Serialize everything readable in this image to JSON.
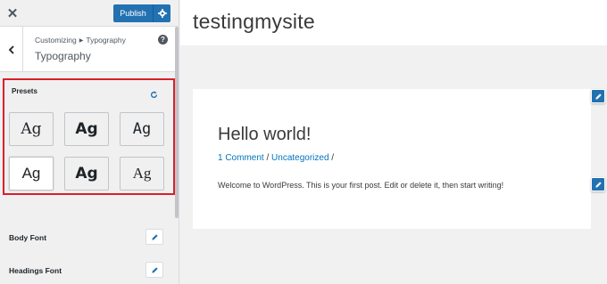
{
  "topbar": {
    "close_icon": "close-icon",
    "publish_label": "Publish",
    "settings_icon": "gear-icon"
  },
  "section": {
    "breadcrumb_root": "Customizing",
    "breadcrumb_current": "Typography",
    "title": "Typography"
  },
  "presets": {
    "label": "Presets",
    "reset_icon": "reset-icon",
    "highlight_color": "#d8202a",
    "items": [
      {
        "label": "Ag",
        "selected": false
      },
      {
        "label": "Ag",
        "selected": false
      },
      {
        "label": "Ag",
        "selected": false
      },
      {
        "label": "Ag",
        "selected": true
      },
      {
        "label": "Ag",
        "selected": false
      },
      {
        "label": "Ag",
        "selected": false
      }
    ]
  },
  "fonts": {
    "body_label": "Body Font",
    "headings_label": "Headings Font",
    "edit_icon": "pencil-icon"
  },
  "preview": {
    "site_title": "testingmysite",
    "post": {
      "title": "Hello world!",
      "comments": "1 Comment",
      "separator": " / ",
      "category": "Uncategorized",
      "trailing": " /",
      "excerpt": "Welcome to WordPress. This is your first post. Edit or delete it, then start writing!"
    }
  },
  "colors": {
    "accent": "#2271b1",
    "link": "#0274be"
  }
}
